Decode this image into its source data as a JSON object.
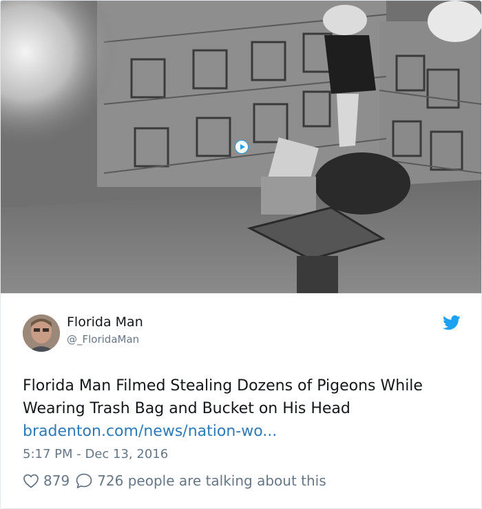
{
  "tweet": {
    "author_name": "Florida Man",
    "author_handle": "@_FloridaMan",
    "text_line1": "Florida Man Filmed Stealing Dozens of Pigeons While",
    "text_line2": "Wearing Trash Bag and Bucket on His Head",
    "link_text": "bradenton.com/news/nation-wo...",
    "timestamp": "5:17 PM - Dec 13, 2016",
    "likes": "879",
    "replies_text": "726 people are talking about this"
  },
  "media": {
    "type": "night-vision surveillance still",
    "play_icon": "play-circle-icon"
  },
  "icons": {
    "brand": "twitter-bird-icon",
    "like": "heart-icon",
    "reply": "speech-bubble-icon"
  },
  "colors": {
    "twitter_blue": "#1da1f2",
    "link": "#2b7bb9",
    "text": "#14171a",
    "secondary_text": "#657786",
    "border": "#e1e8ed"
  }
}
